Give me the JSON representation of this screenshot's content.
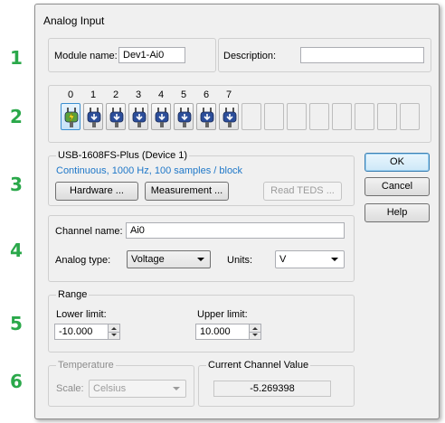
{
  "side_numbers": [
    "1",
    "2",
    "3",
    "4",
    "5",
    "6"
  ],
  "dialog": {
    "title": "Analog Input"
  },
  "module": {
    "name_label": "Module name:",
    "name_value": "Dev1-Ai0",
    "desc_label": "Description:",
    "desc_value": ""
  },
  "channels": {
    "numbers": [
      "0",
      "1",
      "2",
      "3",
      "4",
      "5",
      "6",
      "7"
    ],
    "selected_index": 0,
    "empty_slots": 8
  },
  "device": {
    "title": "USB-1608FS-Plus (Device 1)",
    "status": "Continuous, 1000 Hz, 100 samples / block",
    "hardware_button": "Hardware ...",
    "measurement_button": "Measurement ...",
    "read_teds_button": "Read TEDS ..."
  },
  "buttons": {
    "ok": "OK",
    "cancel": "Cancel",
    "help": "Help"
  },
  "channel": {
    "name_label": "Channel name:",
    "name_value": "Ai0",
    "analog_type_label": "Analog type:",
    "analog_type_value": "Voltage",
    "units_label": "Units:",
    "units_value": "V"
  },
  "range": {
    "title": "Range",
    "lower_label": "Lower limit:",
    "lower_value": "-10.000",
    "upper_label": "Upper limit:",
    "upper_value": "10.000"
  },
  "temperature": {
    "title": "Temperature",
    "scale_label": "Scale:",
    "scale_value": "Celsius"
  },
  "current": {
    "title": "Current Channel Value",
    "value": "-5.269398"
  },
  "colors": {
    "accent": "#2aa84a",
    "link": "#1e77c8",
    "selected_tile": "#3a8fd0"
  },
  "icons": {
    "channel_active": "plug-lightning-icon",
    "channel": "plug-icon"
  }
}
